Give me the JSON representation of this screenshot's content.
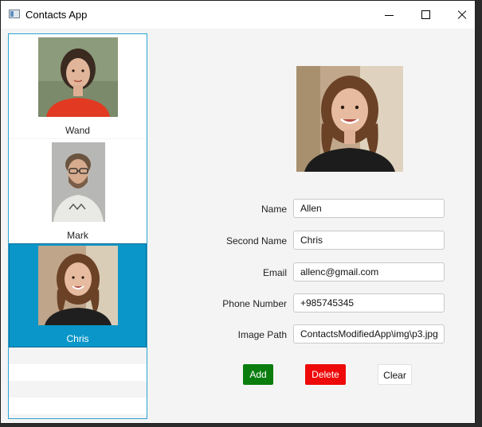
{
  "window": {
    "title": "Contacts App"
  },
  "contacts": [
    {
      "name": "Wand"
    },
    {
      "name": "Mark"
    },
    {
      "name": "Chris"
    }
  ],
  "form": {
    "name_label": "Name",
    "name_value": "Allen",
    "second_name_label": "Second Name",
    "second_name_value": "Chris",
    "email_label": "Email",
    "email_value": "allenc@gmail.com",
    "phone_label": "Phone Number",
    "phone_value": "+985745345",
    "image_path_label": "Image Path",
    "image_path_value": "ContactsModifiedApp\\img\\p3.jpg"
  },
  "actions": {
    "add": "Add",
    "delete": "Delete",
    "clear": "Clear"
  },
  "colors": {
    "selected_row": "#0a96c8",
    "list_border": "#2aa3d6",
    "add_button": "#0a7d0e",
    "delete_button": "#ee0a0a"
  }
}
